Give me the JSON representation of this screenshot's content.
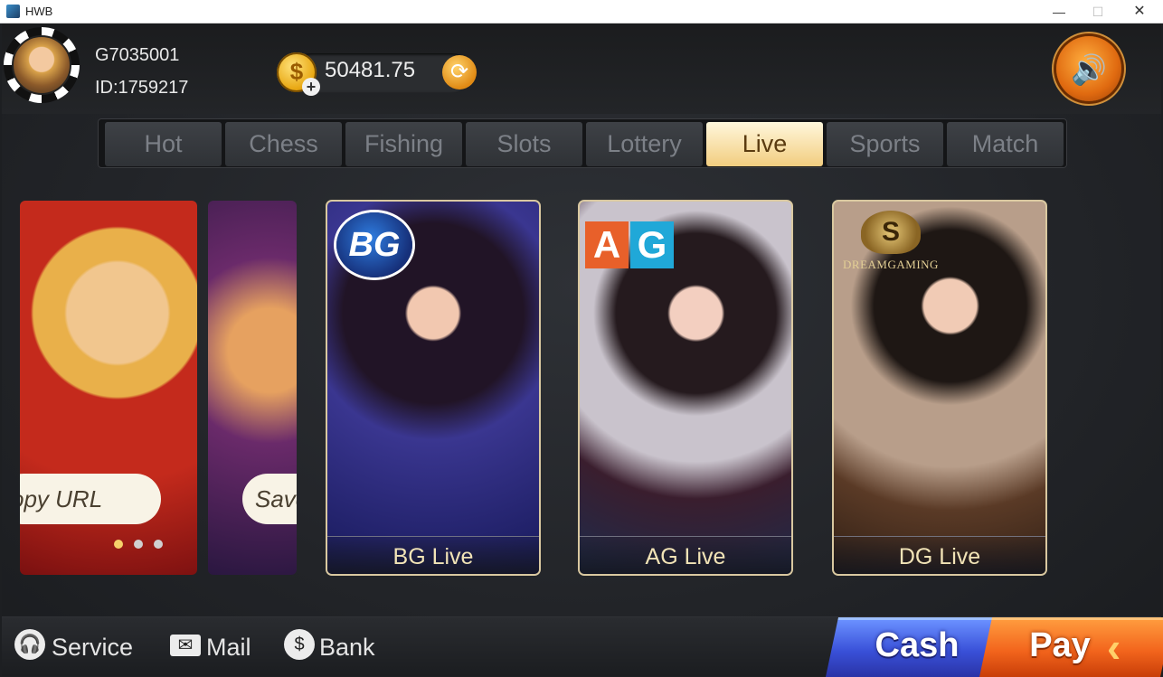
{
  "window": {
    "title": "HWB",
    "minimize": "—",
    "maximize": "☐",
    "close": "✕"
  },
  "user": {
    "name": "G7035001",
    "id": "ID:1759217"
  },
  "balance": {
    "amount": "50481.75",
    "coin_glyph": "$",
    "plus_glyph": "+",
    "refresh_glyph": "⟳"
  },
  "sound_glyph": "🔊",
  "tabs": [
    {
      "label": "Hot"
    },
    {
      "label": "Chess"
    },
    {
      "label": "Fishing"
    },
    {
      "label": "Slots"
    },
    {
      "label": "Lottery"
    },
    {
      "label": "Live",
      "active": true
    },
    {
      "label": "Sports"
    },
    {
      "label": "Match"
    }
  ],
  "banner": {
    "slide_a_text": "opy URL",
    "slide_b_text": "Save",
    "dots": 3,
    "active_dot": 0
  },
  "games": [
    {
      "label": "BG Live",
      "logo": "BG"
    },
    {
      "label": "AG Live",
      "logo_a": "A",
      "logo_g": "G"
    },
    {
      "label": "DG Live",
      "logo_crest": "S",
      "logo_text": "DREAMGAMING"
    }
  ],
  "footer": {
    "service": "Service",
    "mail": "Mail",
    "bank": "Bank",
    "service_icon": "🎧",
    "mail_icon": "✉",
    "bank_icon": "$",
    "cash": "Cash",
    "pay": "Pay",
    "pay_chevron": "‹"
  },
  "colors": {
    "active_tab": "#f2cd7f",
    "cash": "#3950d8",
    "pay": "#f2641c",
    "card_label": "#f1e3b6"
  }
}
